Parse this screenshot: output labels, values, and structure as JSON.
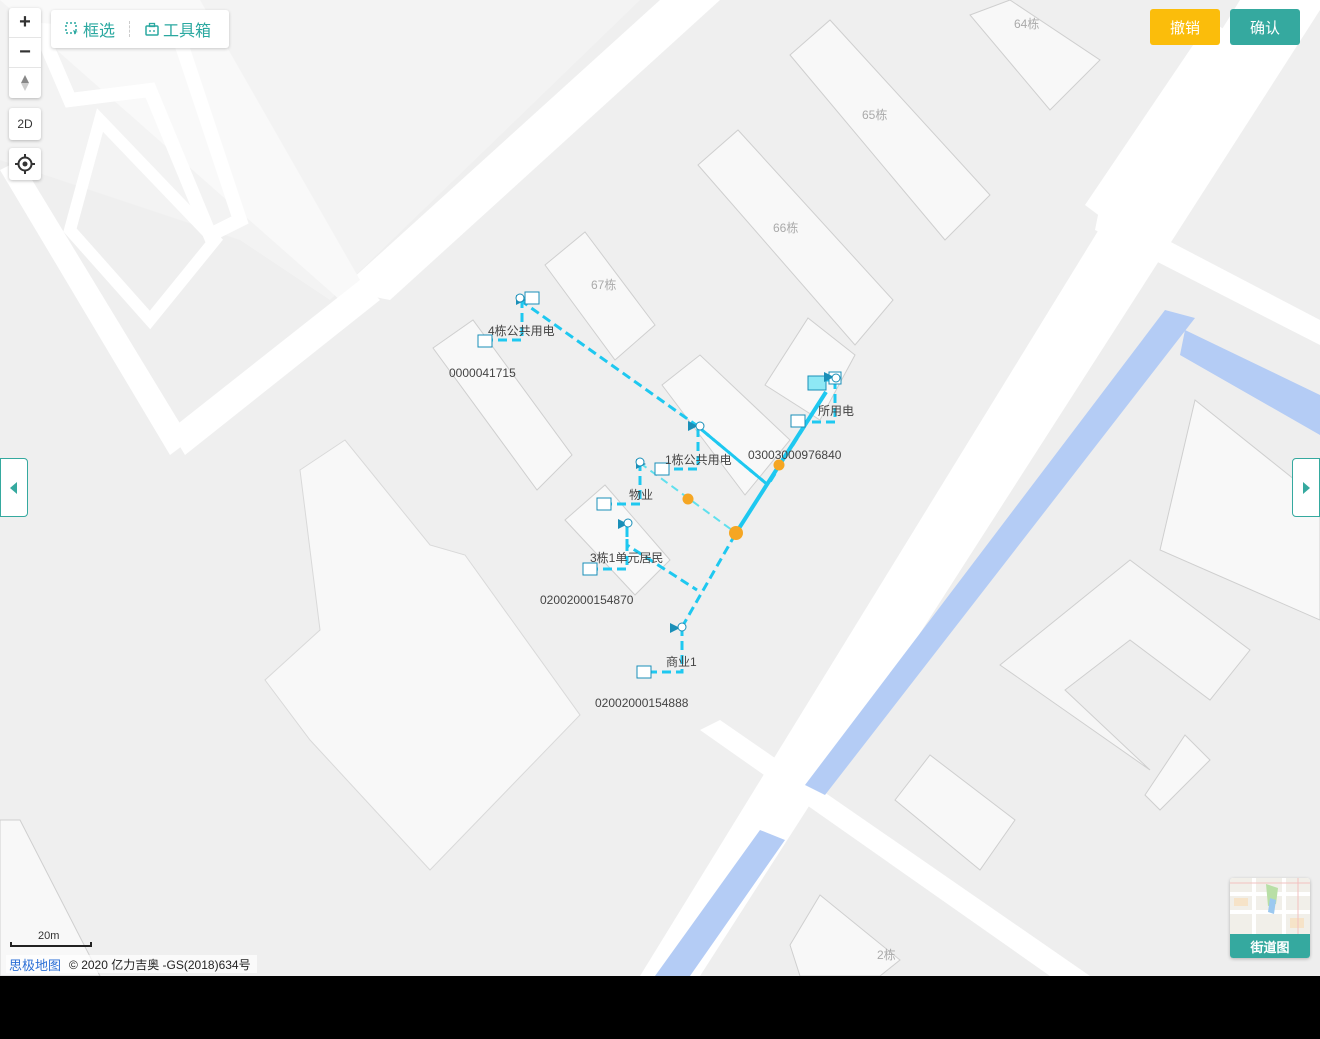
{
  "map_controls": {
    "zoom_in": "+",
    "zoom_out": "−",
    "view_2d": "2D"
  },
  "toolbar": {
    "box_select": "框选",
    "toolbox": "工具箱"
  },
  "actions": {
    "cancel": "撤销",
    "confirm": "确认"
  },
  "buildings": {
    "b64": "64栋",
    "b65": "65栋",
    "b66": "66栋",
    "b67": "67栋",
    "b2": "2栋"
  },
  "network_labels": {
    "l4_public": "4栋公共用电",
    "id_41715": "0000041715",
    "suo_yong_dian": "所用电",
    "id_976840": "03003000976840",
    "l1_public": "1栋公共用电",
    "wuye": "物业",
    "l3_resident": "3栋1单元居民",
    "id_154870": "02002000154870",
    "shangye": "商业1",
    "id_154888": "02002000154888"
  },
  "street_view": {
    "label": "街道图"
  },
  "scale": {
    "label": "20m"
  },
  "attribution": {
    "logo": "思极地图",
    "text": "© 2020 亿力吉奥 -GS(2018)634号"
  },
  "colors": {
    "accent": "#35a99f",
    "cancel": "#fbbd0b",
    "line": "#1ec8f0",
    "node": "#f5a623",
    "river": "#b4ccf5"
  }
}
